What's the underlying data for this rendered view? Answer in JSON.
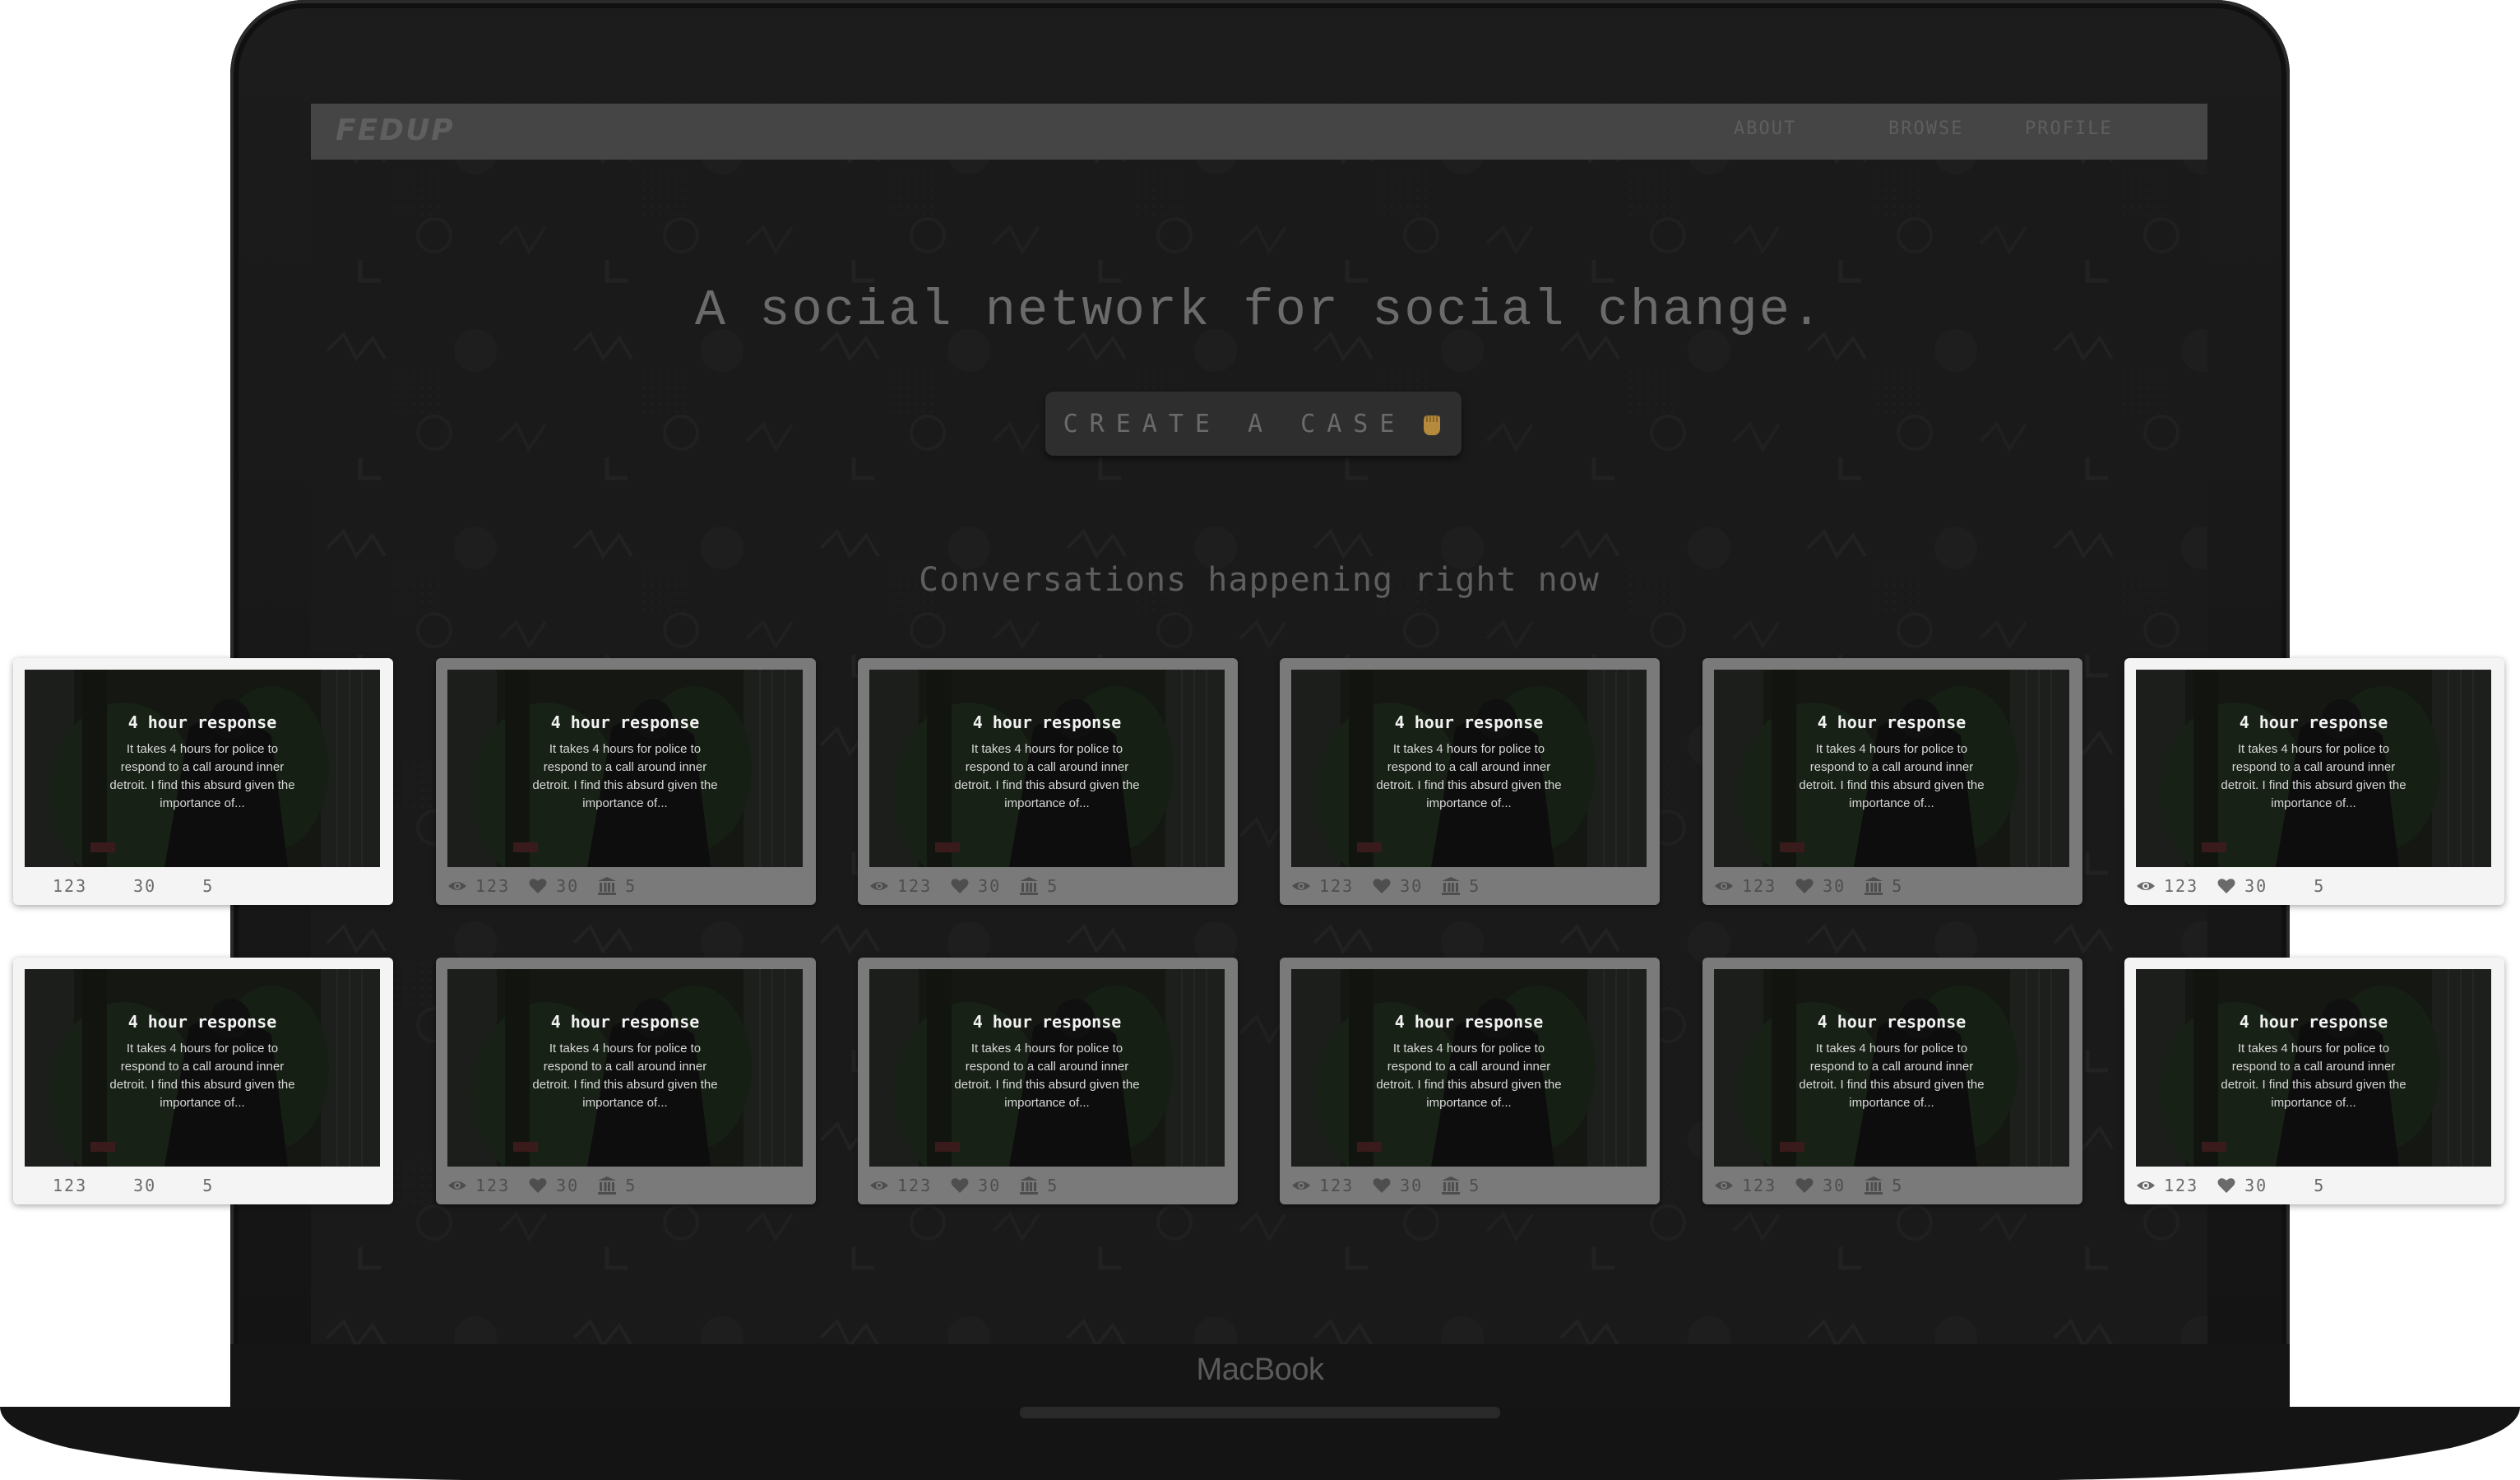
{
  "nav": {
    "logo": "FEDUP",
    "links": [
      "ABOUT",
      "BROWSE",
      "PROFILE"
    ]
  },
  "hero": {
    "title": "A social network for social change.",
    "cta_label": "CREATE A CASE"
  },
  "section": {
    "title": "Conversations happening right now"
  },
  "device": {
    "label": "MacBook"
  },
  "cards": [
    {
      "title": "4 hour response",
      "description": "It takes 4 hours for police to respond to a call around inner detroit. I find this absurd given the importance of...",
      "views": "123",
      "likes": "30",
      "cases": "5"
    },
    {
      "title": "4 hour response",
      "description": "It takes 4 hours for police to respond to a call around inner detroit. I find this absurd given the importance of...",
      "views": "123",
      "likes": "30",
      "cases": "5"
    },
    {
      "title": "4 hour response",
      "description": "It takes 4 hours for police to respond to a call around inner detroit. I find this absurd given the importance of...",
      "views": "123",
      "likes": "30",
      "cases": "5"
    },
    {
      "title": "4 hour response",
      "description": "It takes 4 hours for police to respond to a call around inner detroit. I find this absurd given the importance of...",
      "views": "123",
      "likes": "30",
      "cases": "5"
    },
    {
      "title": "4 hour response",
      "description": "It takes 4 hours for police to respond to a call around inner detroit. I find this absurd given the importance of...",
      "views": "123",
      "likes": "30",
      "cases": "5"
    },
    {
      "title": "4 hour response",
      "description": "It takes 4 hours for police to respond to a call around inner detroit. I find this absurd given the importance of...",
      "views": "123",
      "likes": "30",
      "cases": "5"
    },
    {
      "title": "4 hour response",
      "description": "It takes 4 hours for police to respond to a call around inner detroit. I find this absurd given the importance of...",
      "views": "123",
      "likes": "30",
      "cases": "5"
    },
    {
      "title": "4 hour response",
      "description": "It takes 4 hours for police to respond to a call around inner detroit. I find this absurd given the importance of...",
      "views": "123",
      "likes": "30",
      "cases": "5"
    },
    {
      "title": "4 hour response",
      "description": "It takes 4 hours for police to respond to a call around inner detroit. I find this absurd given the importance of...",
      "views": "123",
      "likes": "30",
      "cases": "5"
    },
    {
      "title": "4 hour response",
      "description": "It takes 4 hours for police to respond to a call around inner detroit. I find this absurd given the importance of...",
      "views": "123",
      "likes": "30",
      "cases": "5"
    },
    {
      "title": "4 hour response",
      "description": "It takes 4 hours for police to respond to a call around inner detroit. I find this absurd given the importance of...",
      "views": "123",
      "likes": "30",
      "cases": "5"
    },
    {
      "title": "4 hour response",
      "description": "It takes 4 hours for police to respond to a call around inner detroit. I find this absurd given the importance of...",
      "views": "123",
      "likes": "30",
      "cases": "5"
    }
  ],
  "icons": {
    "stats": [
      "eye-icon",
      "heart-icon",
      "institution-icon"
    ],
    "cta": "raised-fist-icon"
  },
  "colors": {
    "cta_icon": "#b58a3c"
  }
}
